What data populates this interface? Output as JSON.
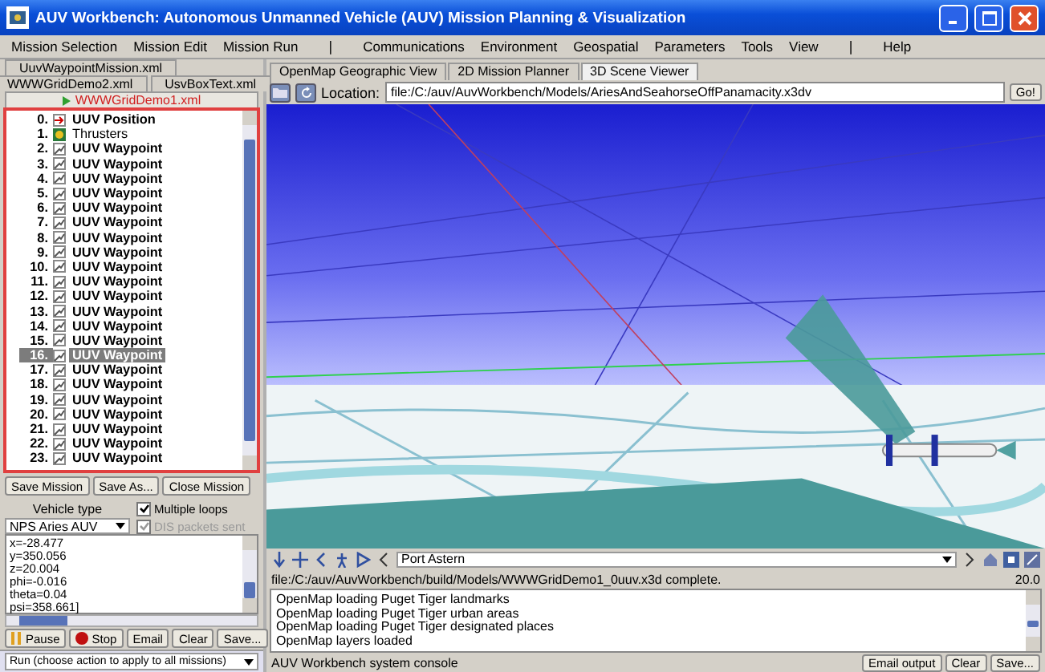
{
  "window": {
    "title": "AUV Workbench:  Autonomous Unmanned Vehicle (AUV) Mission Planning & Visualization"
  },
  "menu": [
    {
      "kind": "item",
      "label": "Mission Selection"
    },
    {
      "kind": "item",
      "label": "Mission Edit"
    },
    {
      "kind": "item",
      "label": "Mission Run"
    },
    {
      "kind": "separator",
      "label": "|"
    },
    {
      "kind": "item",
      "label": "Communications"
    },
    {
      "kind": "item",
      "label": "Environment"
    },
    {
      "kind": "item",
      "label": "Geospatial"
    },
    {
      "kind": "item",
      "label": "Parameters"
    },
    {
      "kind": "item",
      "label": "Tools"
    },
    {
      "kind": "item",
      "label": "View"
    },
    {
      "kind": "separator",
      "label": "|"
    },
    {
      "kind": "item",
      "label": "Help"
    }
  ],
  "mission_tab_rows": [
    {
      "tabs": [
        {
          "label": "UuvWaypointMission.xml",
          "selected": false
        }
      ]
    },
    {
      "tabs": [
        {
          "label": "WWWGridDemo2.xml",
          "selected": false
        },
        {
          "label": "UsvBoxText.xml",
          "selected": false
        }
      ]
    },
    {
      "tabs": [
        {
          "label": "WWWGridDemo1.xml",
          "selected": true
        }
      ]
    }
  ],
  "mission_items": [
    {
      "number": "0.",
      "label": "UUV Position",
      "kind": "position",
      "selected": false
    },
    {
      "number": "1.",
      "label": "Thrusters",
      "kind": "thrusters",
      "selected": false
    },
    {
      "number": "2.",
      "label": "UUV Waypoint",
      "kind": "waypoint",
      "selected": false
    },
    {
      "number": "3.",
      "label": "UUV Waypoint",
      "kind": "waypoint",
      "selected": false
    },
    {
      "number": "4.",
      "label": "UUV Waypoint",
      "kind": "waypoint",
      "selected": false
    },
    {
      "number": "5.",
      "label": "UUV Waypoint",
      "kind": "waypoint",
      "selected": false
    },
    {
      "number": "6.",
      "label": "UUV Waypoint",
      "kind": "waypoint",
      "selected": false
    },
    {
      "number": "7.",
      "label": "UUV Waypoint",
      "kind": "waypoint",
      "selected": false
    },
    {
      "number": "8.",
      "label": "UUV Waypoint",
      "kind": "waypoint",
      "selected": false
    },
    {
      "number": "9.",
      "label": "UUV Waypoint",
      "kind": "waypoint",
      "selected": false
    },
    {
      "number": "10.",
      "label": "UUV Waypoint",
      "kind": "waypoint",
      "selected": false
    },
    {
      "number": "11.",
      "label": "UUV Waypoint",
      "kind": "waypoint",
      "selected": false
    },
    {
      "number": "12.",
      "label": "UUV Waypoint",
      "kind": "waypoint",
      "selected": false
    },
    {
      "number": "13.",
      "label": "UUV Waypoint",
      "kind": "waypoint",
      "selected": false
    },
    {
      "number": "14.",
      "label": "UUV Waypoint",
      "kind": "waypoint",
      "selected": false
    },
    {
      "number": "15.",
      "label": "UUV Waypoint",
      "kind": "waypoint",
      "selected": false
    },
    {
      "number": "16.",
      "label": "UUV Waypoint",
      "kind": "waypoint",
      "selected": true
    },
    {
      "number": "17.",
      "label": "UUV Waypoint",
      "kind": "waypoint",
      "selected": false
    },
    {
      "number": "18.",
      "label": "UUV Waypoint",
      "kind": "waypoint",
      "selected": false
    },
    {
      "number": "19.",
      "label": "UUV Waypoint",
      "kind": "waypoint",
      "selected": false
    },
    {
      "number": "20.",
      "label": "UUV Waypoint",
      "kind": "waypoint",
      "selected": false
    },
    {
      "number": "21.",
      "label": "UUV Waypoint",
      "kind": "waypoint",
      "selected": false
    },
    {
      "number": "22.",
      "label": "UUV Waypoint",
      "kind": "waypoint",
      "selected": false
    },
    {
      "number": "23.",
      "label": "UUV Waypoint",
      "kind": "waypoint",
      "selected": false
    }
  ],
  "mission_buttons": [
    "Save Mission",
    "Save As...",
    "Close Mission"
  ],
  "vehicle": {
    "label": "Vehicle type",
    "value": "NPS Aries AUV"
  },
  "options": [
    {
      "label": "Multiple loops",
      "checked": true,
      "disabled": false
    },
    {
      "label": "DIS packets sent",
      "checked": true,
      "disabled": true
    }
  ],
  "telemetry": [
    "x=-28.477",
    "y=350.056",
    "z=20.004",
    "phi=-0.016",
    "theta=0.04",
    "psi=358.661]"
  ],
  "run_buttons": [
    {
      "label": "Pause",
      "kind": "pause"
    },
    {
      "label": "Stop",
      "kind": "stop"
    },
    {
      "label": "Email",
      "kind": "plain"
    },
    {
      "label": "Clear",
      "kind": "plain"
    },
    {
      "label": "Save...",
      "kind": "plain"
    }
  ],
  "run_action": "Run (choose action to apply to all missions)",
  "view_tabs": [
    {
      "label": "OpenMap Geographic View",
      "selected": false
    },
    {
      "label": "2D Mission Planner",
      "selected": false
    },
    {
      "label": "3D Scene Viewer",
      "selected": true
    }
  ],
  "location": {
    "label": "Location:",
    "value": "file:/C:/auv/AuvWorkbench/Models/AriesAndSeahorseOffPanamacity.x3dv",
    "button": "Go!"
  },
  "viewpoint": "Port Astern",
  "status": {
    "text": "file:/C:/auv/AuvWorkbench/build/Models/WWWGridDemo1_0uuv.x3d complete.",
    "value": "20.0"
  },
  "console": {
    "lines": [
      "OpenMap loading Puget Tiger landmarks",
      "OpenMap loading Puget Tiger urban areas",
      "OpenMap loading Puget Tiger designated places",
      "OpenMap layers loaded"
    ],
    "label": "AUV Workbench system console",
    "buttons": [
      "Email output",
      "Clear",
      "Save..."
    ]
  }
}
